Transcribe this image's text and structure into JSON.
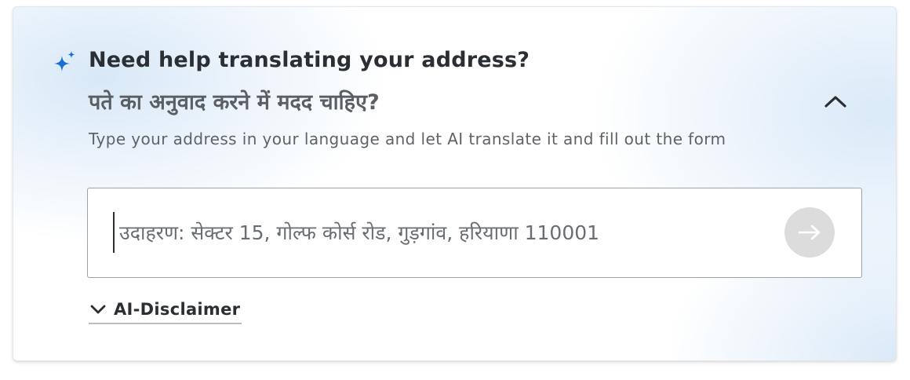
{
  "header": {
    "title": "Need help translating your address?",
    "subtitle_hindi": "पते का अनुवाद करने में मदद चाहिए?",
    "description": "Type your address in your language and let AI translate it and fill out the form",
    "icon": "sparkle-icon",
    "collapse_icon": "chevron-up-icon"
  },
  "address_input": {
    "value": "",
    "placeholder": "उदाहरण: सेक्टर 15, गोल्फ कोर्स रोड, गुड़गांव, हरियाणा 110001",
    "submit_icon": "arrow-right-icon"
  },
  "disclaimer": {
    "label": "AI-Disclaimer",
    "icon": "chevron-down-icon"
  },
  "colors": {
    "accent": "#1a6fd1",
    "text_primary": "#2b2f33",
    "text_secondary": "#5f6368",
    "submit_disabled": "#dcdcdc",
    "gradient_tint": "#d6e7f7"
  }
}
